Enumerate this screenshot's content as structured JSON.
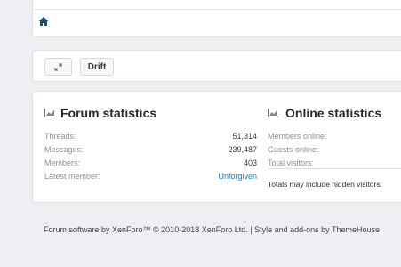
{
  "navigation": {
    "home_icon": "home-icon"
  },
  "toolbar": {
    "expand_icon": "expand-icon",
    "drift_label": "Drift"
  },
  "forum_statistics": {
    "title": "Forum statistics",
    "icon": "chart-icon",
    "rows": [
      {
        "label": "Threads:",
        "value": "51,314"
      },
      {
        "label": "Messages:",
        "value": "239,487"
      },
      {
        "label": "Members:",
        "value": "403"
      },
      {
        "label": "Latest member:",
        "value": "Unforgiven"
      }
    ]
  },
  "online_statistics": {
    "title": "Online statistics",
    "icon": "chart-icon",
    "rows": [
      {
        "label": "Members online:"
      },
      {
        "label": "Guests online:"
      },
      {
        "label": "Total visitors:"
      }
    ],
    "note": "Totals may include hidden visitors."
  },
  "footer": {
    "text": "Forum software by XenForo™ © 2010-2018 XenForo Ltd. | Style and add-ons by ThemeHouse"
  },
  "colors": {
    "link": "#2577b1",
    "background": "#edeff2",
    "card": "#ffffff"
  }
}
